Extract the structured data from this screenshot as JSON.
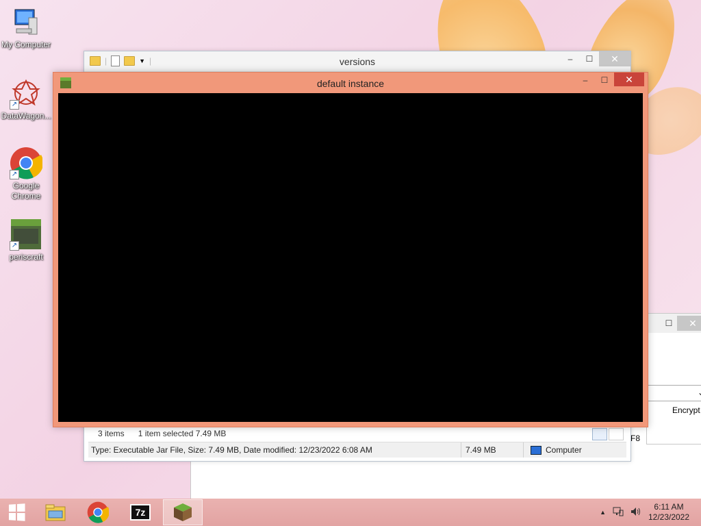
{
  "desktop": {
    "icons": [
      {
        "label": "My Computer",
        "icon": "computer-icon"
      },
      {
        "label": "DataWagon...",
        "icon": "datawagon-icon"
      },
      {
        "label": "Google Chrome",
        "icon": "chrome-icon"
      },
      {
        "label": "periscraft",
        "icon": "betacraft-icon"
      }
    ]
  },
  "explorer": {
    "title": "versions",
    "status": {
      "items": "3 items",
      "selected": "1 item selected  7.49 MB"
    },
    "details": {
      "type_info": "Type: Executable Jar File, Size: 7.49 MB, Date modified: 12/23/2022 6:08 AM",
      "size": "7.49 MB",
      "location": "Computer"
    }
  },
  "game_window": {
    "title": "default instance"
  },
  "background_window": {
    "column_label": "Encrypt",
    "fragment": "F8"
  },
  "window_controls": {
    "minimize": "–",
    "maximize": "☐",
    "close": "✕"
  },
  "taskbar": {
    "apps": [
      {
        "name": "file-explorer",
        "label": ""
      },
      {
        "name": "chrome",
        "label": ""
      },
      {
        "name": "7zip",
        "label": "7z"
      },
      {
        "name": "minecraft",
        "label": ""
      }
    ],
    "tray": {
      "up_arrow": "▲",
      "time": "6:11 AM",
      "date": "12/23/2022"
    }
  },
  "colors": {
    "game_frame": "#f1987a",
    "close_red": "#c9443a",
    "taskbar": "#e5a8a8"
  }
}
